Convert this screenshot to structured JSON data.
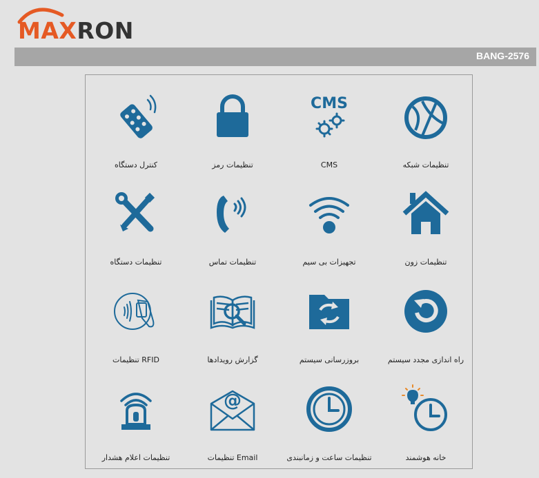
{
  "brand": {
    "logo_part1": "MAX",
    "logo_part2": "RON",
    "accent_color": "#e55a24",
    "icon_color": "#1e6a9a"
  },
  "header": {
    "device_id": "BANG-2576"
  },
  "tiles": [
    {
      "label": "کنترل دستگاه",
      "icon": "remote-control-icon"
    },
    {
      "label": "تنظیمات رمز",
      "icon": "lock-icon"
    },
    {
      "label": "CMS",
      "icon": "cms-gears-icon"
    },
    {
      "label": "تنظیمات شبکه",
      "icon": "globe-network-icon"
    },
    {
      "label": "تنظیمات دستگاه",
      "icon": "tools-icon"
    },
    {
      "label": "تنظیمات تماس",
      "icon": "phone-icon"
    },
    {
      "label": "تجهیزات بی سیم",
      "icon": "wifi-icon"
    },
    {
      "label": "تنظیمات زون",
      "icon": "home-icon"
    },
    {
      "label": "تنظیمات RFID",
      "icon": "rfid-icon"
    },
    {
      "label": "گزارش رویدادها",
      "icon": "event-log-icon"
    },
    {
      "label": "بروزرسانی سیستم",
      "icon": "update-icon"
    },
    {
      "label": "راه اندازی مجدد سیستم",
      "icon": "restart-icon"
    },
    {
      "label": "تنظیمات اعلام هشدار",
      "icon": "alarm-icon"
    },
    {
      "label": "تنظیمات Email",
      "icon": "email-icon"
    },
    {
      "label": "تنظیمات ساعت و زمانبندی",
      "icon": "clock-icon"
    },
    {
      "label": "خانه هوشمند",
      "icon": "smart-home-icon"
    }
  ]
}
